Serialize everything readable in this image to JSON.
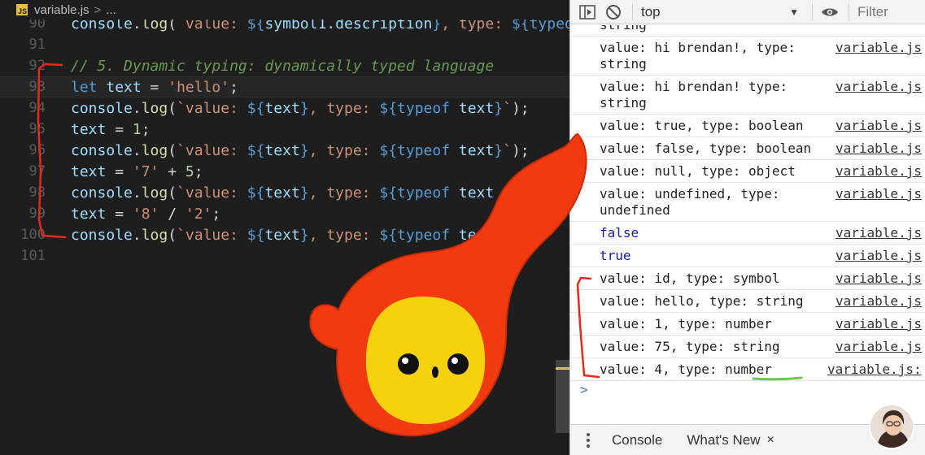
{
  "editor": {
    "breadcrumb": {
      "badge": "JS",
      "file": "variable.js",
      "sep": ">",
      "rest": "..."
    },
    "lines": [
      {
        "ln": "90",
        "tokens": [
          {
            "c": "tk-var",
            "t": "console"
          },
          {
            "c": "tk-plain",
            "t": "."
          },
          {
            "c": "tk-fn",
            "t": "log"
          },
          {
            "c": "tk-plain",
            "t": "("
          },
          {
            "c": "tk-str",
            "t": "`value: "
          },
          {
            "c": "tk-kw",
            "t": "${"
          },
          {
            "c": "tk-var",
            "t": "symbol1.description"
          },
          {
            "c": "tk-kw",
            "t": "}"
          },
          {
            "c": "tk-str",
            "t": ", type: "
          },
          {
            "c": "tk-kw",
            "t": "${"
          },
          {
            "c": "tk-kw",
            "t": "typeof"
          }
        ]
      },
      {
        "ln": "91",
        "tokens": []
      },
      {
        "ln": "92",
        "tokens": [
          {
            "c": "tk-comment",
            "t": "// 5. Dynamic typing: dynamically typed language"
          }
        ]
      },
      {
        "ln": "93",
        "active": true,
        "tokens": [
          {
            "c": "tk-kw",
            "t": "let "
          },
          {
            "c": "tk-var",
            "t": "text"
          },
          {
            "c": "tk-plain",
            "t": " = "
          },
          {
            "c": "tk-str",
            "t": "'hello'"
          },
          {
            "c": "tk-plain",
            "t": ";"
          }
        ]
      },
      {
        "ln": "94",
        "tokens": [
          {
            "c": "tk-var",
            "t": "console"
          },
          {
            "c": "tk-plain",
            "t": "."
          },
          {
            "c": "tk-fn",
            "t": "log"
          },
          {
            "c": "tk-plain",
            "t": "("
          },
          {
            "c": "tk-str",
            "t": "`value: "
          },
          {
            "c": "tk-kw",
            "t": "${"
          },
          {
            "c": "tk-var",
            "t": "text"
          },
          {
            "c": "tk-kw",
            "t": "}"
          },
          {
            "c": "tk-str",
            "t": ", type: "
          },
          {
            "c": "tk-kw",
            "t": "${"
          },
          {
            "c": "tk-kw",
            "t": "typeof "
          },
          {
            "c": "tk-var",
            "t": "text"
          },
          {
            "c": "tk-kw",
            "t": "}"
          },
          {
            "c": "tk-str",
            "t": "`"
          },
          {
            "c": "tk-plain",
            "t": ");"
          }
        ]
      },
      {
        "ln": "95",
        "tokens": [
          {
            "c": "tk-var",
            "t": "text"
          },
          {
            "c": "tk-plain",
            "t": " = "
          },
          {
            "c": "tk-num",
            "t": "1"
          },
          {
            "c": "tk-plain",
            "t": ";"
          }
        ]
      },
      {
        "ln": "96",
        "tokens": [
          {
            "c": "tk-var",
            "t": "console"
          },
          {
            "c": "tk-plain",
            "t": "."
          },
          {
            "c": "tk-fn",
            "t": "log"
          },
          {
            "c": "tk-plain",
            "t": "("
          },
          {
            "c": "tk-str",
            "t": "`value: "
          },
          {
            "c": "tk-kw",
            "t": "${"
          },
          {
            "c": "tk-var",
            "t": "text"
          },
          {
            "c": "tk-kw",
            "t": "}"
          },
          {
            "c": "tk-str",
            "t": ", type: "
          },
          {
            "c": "tk-kw",
            "t": "${"
          },
          {
            "c": "tk-kw",
            "t": "typeof "
          },
          {
            "c": "tk-var",
            "t": "text"
          },
          {
            "c": "tk-kw",
            "t": "}"
          },
          {
            "c": "tk-str",
            "t": "`"
          },
          {
            "c": "tk-plain",
            "t": ");"
          }
        ]
      },
      {
        "ln": "97",
        "tokens": [
          {
            "c": "tk-var",
            "t": "text"
          },
          {
            "c": "tk-plain",
            "t": " = "
          },
          {
            "c": "tk-str",
            "t": "'7'"
          },
          {
            "c": "tk-plain",
            "t": " + "
          },
          {
            "c": "tk-num",
            "t": "5"
          },
          {
            "c": "tk-plain",
            "t": ";"
          }
        ]
      },
      {
        "ln": "98",
        "tokens": [
          {
            "c": "tk-var",
            "t": "console"
          },
          {
            "c": "tk-plain",
            "t": "."
          },
          {
            "c": "tk-fn",
            "t": "log"
          },
          {
            "c": "tk-plain",
            "t": "("
          },
          {
            "c": "tk-str",
            "t": "`value: "
          },
          {
            "c": "tk-kw",
            "t": "${"
          },
          {
            "c": "tk-var",
            "t": "text"
          },
          {
            "c": "tk-kw",
            "t": "}"
          },
          {
            "c": "tk-str",
            "t": ", type: "
          },
          {
            "c": "tk-kw",
            "t": "${"
          },
          {
            "c": "tk-kw",
            "t": "typeof "
          },
          {
            "c": "tk-var",
            "t": "text"
          }
        ]
      },
      {
        "ln": "99",
        "tokens": [
          {
            "c": "tk-var",
            "t": "text"
          },
          {
            "c": "tk-plain",
            "t": " = "
          },
          {
            "c": "tk-str",
            "t": "'8'"
          },
          {
            "c": "tk-plain",
            "t": " / "
          },
          {
            "c": "tk-str",
            "t": "'2'"
          },
          {
            "c": "tk-plain",
            "t": ";"
          }
        ]
      },
      {
        "ln": "100",
        "tokens": [
          {
            "c": "tk-var",
            "t": "console"
          },
          {
            "c": "tk-plain",
            "t": "."
          },
          {
            "c": "tk-fn",
            "t": "log"
          },
          {
            "c": "tk-plain",
            "t": "("
          },
          {
            "c": "tk-str",
            "t": "`value: "
          },
          {
            "c": "tk-kw",
            "t": "${"
          },
          {
            "c": "tk-var",
            "t": "text"
          },
          {
            "c": "tk-kw",
            "t": "}"
          },
          {
            "c": "tk-str",
            "t": ", type: "
          },
          {
            "c": "tk-kw",
            "t": "${"
          },
          {
            "c": "tk-kw",
            "t": "typeof "
          },
          {
            "c": "tk-var",
            "t": "tex"
          }
        ]
      },
      {
        "ln": "101",
        "tokens": []
      }
    ]
  },
  "devtools": {
    "toolbar": {
      "context": "top",
      "filter_placeholder": "Filter"
    },
    "messages": [
      {
        "text": "string",
        "src": "",
        "blue": false,
        "clipped": true
      },
      {
        "text": "value: hi brendan!, type:\nstring",
        "src": "variable.js",
        "blue": false
      },
      {
        "text": "value: hi brendan! type:\nstring",
        "src": "variable.js",
        "blue": false
      },
      {
        "text": "value: true, type: boolean",
        "src": "variable.js",
        "blue": false
      },
      {
        "text": "value: false, type: boolean",
        "src": "variable.js",
        "blue": false
      },
      {
        "text": "value: null, type: object",
        "src": "variable.js",
        "blue": false
      },
      {
        "text": "value: undefined, type:\nundefined",
        "src": "variable.js",
        "blue": false
      },
      {
        "text": "false",
        "src": "variable.js",
        "blue": true
      },
      {
        "text": "true",
        "src": "variable.js",
        "blue": true
      },
      {
        "text": "value: id, type: symbol",
        "src": "variable.js",
        "blue": false
      },
      {
        "text": "value: hello, type: string",
        "src": "variable.js",
        "blue": false
      },
      {
        "text": "value: 1, type: number",
        "src": "variable.js",
        "blue": false
      },
      {
        "text": "value: 75, type: string",
        "src": "variable.js",
        "blue": false
      },
      {
        "text": "value: 4, type: number",
        "src": "variable.js:",
        "blue": false
      }
    ],
    "prompt": ">",
    "drawer": {
      "tab_console": "Console",
      "tab_whats_new": "What's New",
      "close": "×"
    }
  },
  "colors": {
    "accent_red": "#e8281c",
    "mascot_red": "#f23a10",
    "mascot_yellow": "#f5d20c",
    "annot_green": "#6cc94a"
  }
}
